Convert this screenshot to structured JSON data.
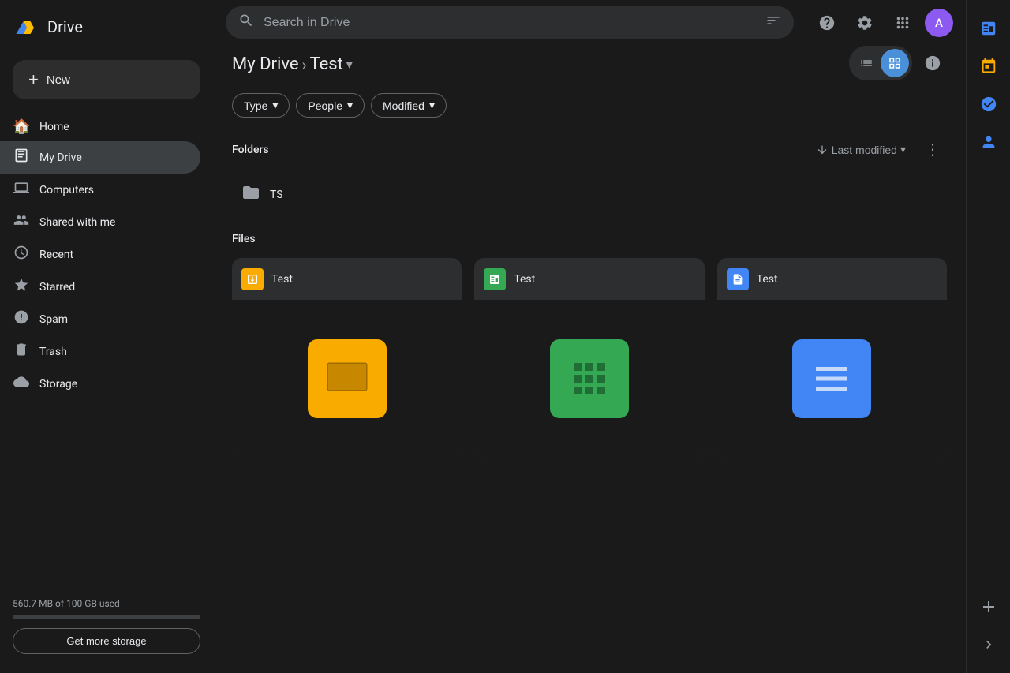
{
  "app": {
    "title": "Drive",
    "logo_alt": "Google Drive"
  },
  "sidebar": {
    "new_button_label": "New",
    "nav_items": [
      {
        "id": "home",
        "label": "Home",
        "icon": "🏠"
      },
      {
        "id": "my-drive",
        "label": "My Drive",
        "icon": "📁",
        "active": true
      },
      {
        "id": "computers",
        "label": "Computers",
        "icon": "💻"
      },
      {
        "id": "shared-with-me",
        "label": "Shared with me",
        "icon": "👥"
      },
      {
        "id": "recent",
        "label": "Recent",
        "icon": "🕐"
      },
      {
        "id": "starred",
        "label": "Starred",
        "icon": "⭐"
      },
      {
        "id": "spam",
        "label": "Spam",
        "icon": "🚫"
      },
      {
        "id": "trash",
        "label": "Trash",
        "icon": "🗑️"
      },
      {
        "id": "storage",
        "label": "Storage",
        "icon": "☁️"
      }
    ],
    "storage": {
      "text": "560.7 MB of 100 GB used",
      "get_more_label": "Get more storage",
      "percent": 0.56
    }
  },
  "topbar": {
    "search": {
      "placeholder": "Search in Drive",
      "value": ""
    },
    "avatar_initials": "A"
  },
  "breadcrumb": {
    "parent": "My Drive",
    "current": "Test"
  },
  "filters": [
    {
      "id": "type",
      "label": "Type"
    },
    {
      "id": "people",
      "label": "People"
    },
    {
      "id": "modified",
      "label": "Modified"
    }
  ],
  "folders_section": {
    "title": "Folders",
    "sort_label": "Last modified",
    "items": [
      {
        "id": "ts",
        "name": "TS"
      }
    ]
  },
  "files_section": {
    "title": "Files",
    "items": [
      {
        "id": "test-slides",
        "name": "Test",
        "type": "slides",
        "type_label": "Slides",
        "color": "#f9ab00"
      },
      {
        "id": "test-sheets",
        "name": "Test",
        "type": "sheets",
        "type_label": "Sheets",
        "color": "#34a853"
      },
      {
        "id": "test-docs",
        "name": "Test",
        "type": "docs",
        "type_label": "Docs",
        "color": "#4285f4"
      }
    ]
  },
  "view_toggle": {
    "list_icon": "☰",
    "grid_icon": "⊞",
    "active": "grid"
  },
  "right_panel": {
    "icons": [
      {
        "id": "calendar",
        "label": "Calendar"
      },
      {
        "id": "tasks",
        "label": "Tasks"
      },
      {
        "id": "contacts",
        "label": "Contacts"
      }
    ]
  }
}
